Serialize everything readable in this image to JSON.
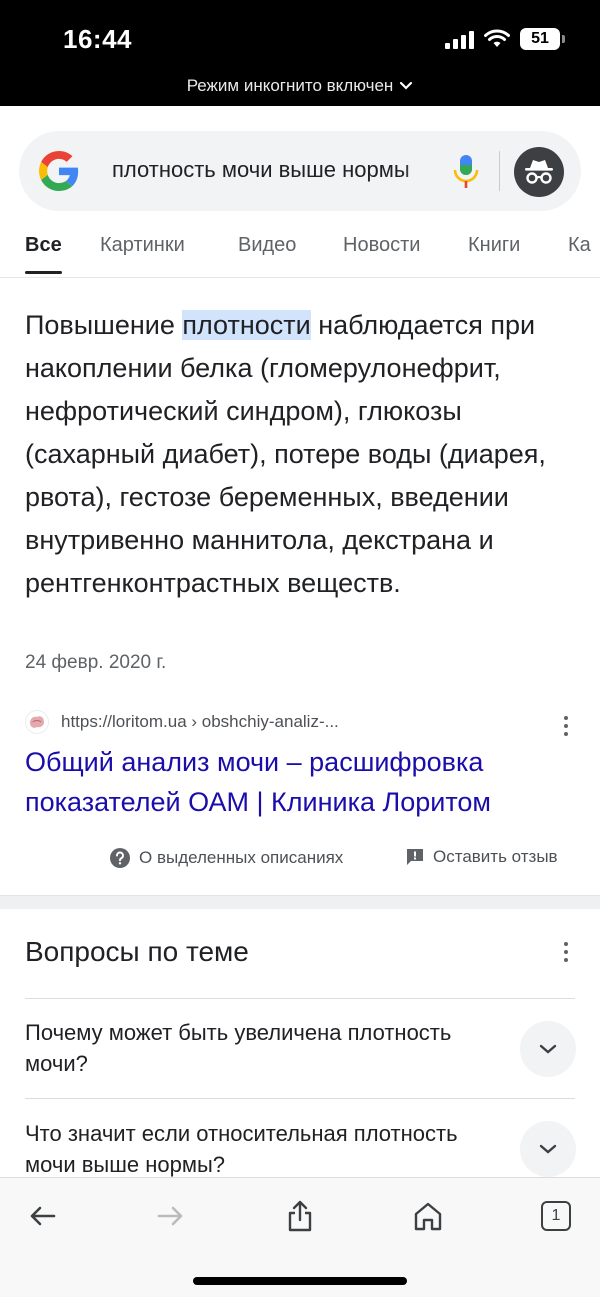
{
  "status_bar": {
    "time": "16:44",
    "battery": "51"
  },
  "incognito_banner": {
    "text": "Режим инкогнито включен"
  },
  "search": {
    "query": "плотность мочи выше нормы"
  },
  "tabs": [
    {
      "label": "Все",
      "active": true
    },
    {
      "label": "Картинки"
    },
    {
      "label": "Видео"
    },
    {
      "label": "Новости"
    },
    {
      "label": "Книги"
    },
    {
      "label": "Ка"
    }
  ],
  "featured_snippet": {
    "text_before": "Повышение ",
    "highlight": "плотности",
    "text_after": " наблюдается при накоплении белка (гломерулонефрит, нефротический синдром), глюкозы (сахарный диабет), потере воды (диарея, рвота), гестозе беременных, введении внутривенно маннитола, декстрана и рентгенконтрастных веществ.",
    "date": "24 февр. 2020 г.",
    "source_url": "https://loritom.ua › obshchiy-analiz-...",
    "link_title": "Общий анализ мочи – расшифровка показателей ОАМ | Клиника Лоритом",
    "about_label": "О выделенных описаниях",
    "feedback_label": "Оставить отзыв"
  },
  "related_questions": {
    "title": "Вопросы по теме",
    "items": [
      {
        "question": "Почему может быть увеличена плотность мочи?"
      },
      {
        "question": "Что значит если относительная плотность мочи выше нормы?"
      }
    ]
  },
  "toolbar": {
    "tab_count": "1"
  }
}
